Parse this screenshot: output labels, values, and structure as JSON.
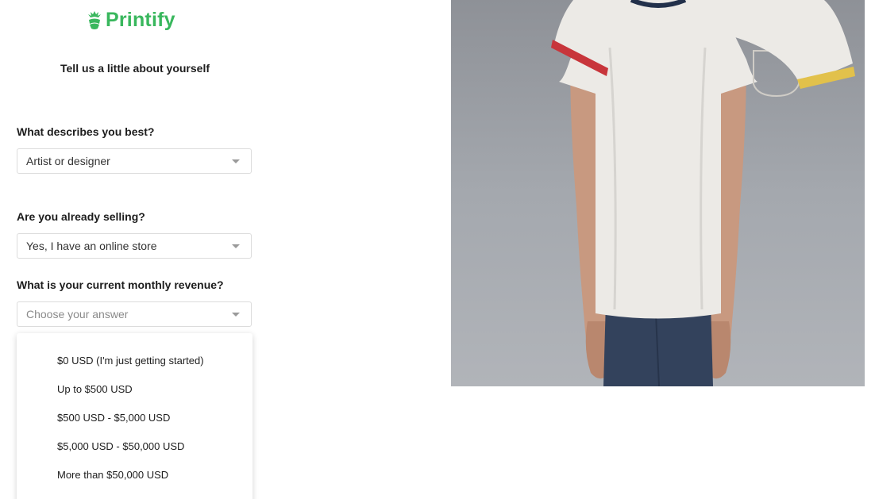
{
  "brand": {
    "name": "Printify",
    "logo_icon": "pineapple-logo-icon",
    "color": "#39b75d"
  },
  "form": {
    "subtitle": "Tell us a little about yourself",
    "q1": {
      "label": "What describes you best?",
      "value": "Artist or designer"
    },
    "q2": {
      "label": "Are you already selling?",
      "value": "Yes, I have an online store"
    },
    "q3": {
      "label": "What is your current monthly revenue?",
      "placeholder": "Choose your answer"
    }
  },
  "dropdown": {
    "options": [
      "$0 USD (I'm just getting started)",
      "Up to $500 USD",
      "$500 USD - $5,000 USD",
      "$5,000 USD - $50,000 USD",
      "More than $50,000 USD"
    ]
  },
  "colors": {
    "shirt_trim_left": "#c8353b",
    "shirt_trim_right": "#e2c14b",
    "background": "#a4a8ae"
  }
}
